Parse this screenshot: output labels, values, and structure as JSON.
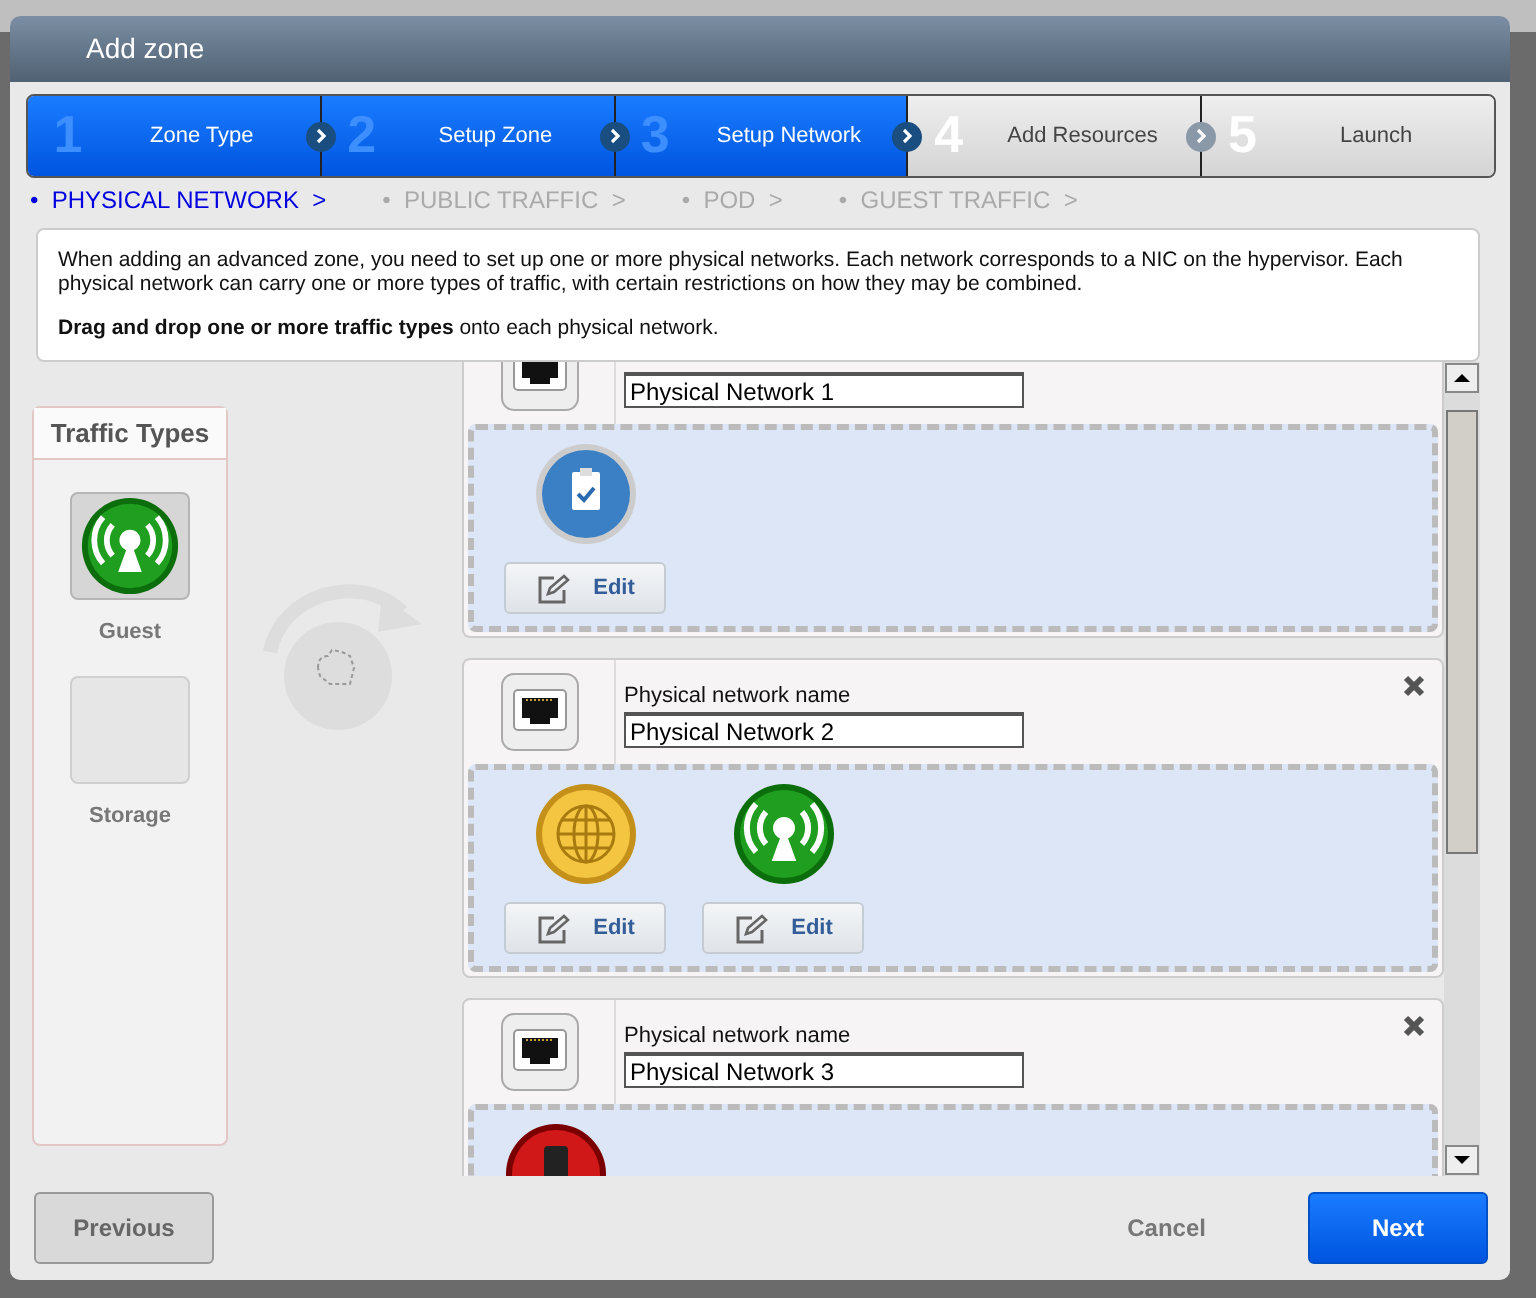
{
  "dialog": {
    "title": "Add zone",
    "steps": [
      {
        "number": "1",
        "label": "Zone Type",
        "completed": true
      },
      {
        "number": "2",
        "label": "Setup Zone",
        "completed": true
      },
      {
        "number": "3",
        "label": "Setup Network",
        "completed": true
      },
      {
        "number": "4",
        "label": "Add Resources",
        "completed": false
      },
      {
        "number": "5",
        "label": "Launch",
        "completed": false
      }
    ],
    "substeps": [
      {
        "bullet": "•",
        "label": "PHYSICAL NETWORK",
        "arrow": ">",
        "selected": true
      },
      {
        "bullet": "•",
        "label": "PUBLIC TRAFFIC",
        "arrow": ">",
        "selected": false
      },
      {
        "bullet": "•",
        "label": "POD",
        "arrow": ">",
        "selected": false
      },
      {
        "bullet": "•",
        "label": "GUEST TRAFFIC",
        "arrow": ">",
        "selected": false
      }
    ],
    "info": {
      "text": "When adding an advanced zone, you need to set up one or more physical networks. Each network corresponds to a NIC on the hypervisor. Each physical network can carry one or more types of traffic, with certain restrictions on how they may be combined.",
      "hint": "**Drag and drop one or more traffic types** onto each physical network."
    },
    "traffic_types": {
      "title": "Traffic Types",
      "items": [
        {
          "label": "Guest",
          "kind": "guest",
          "empty": false
        },
        {
          "label": "Storage",
          "empty": true
        }
      ]
    },
    "networks": [
      {
        "name_value": "Physical Network 1",
        "removable": false,
        "traffic": [
          {
            "kind": "management",
            "edit": "Edit"
          }
        ]
      },
      {
        "name_label": "Physical network name",
        "name_value": "Physical Network 2",
        "removable": true,
        "traffic": [
          {
            "kind": "public",
            "edit": "Edit"
          },
          {
            "kind": "guest",
            "edit": "Edit"
          }
        ]
      },
      {
        "name_label": "Physical network name",
        "name_value": "Physical Network 3",
        "removable": true,
        "traffic": [
          {
            "kind": "storage"
          }
        ]
      }
    ],
    "buttons": {
      "previous": "Previous",
      "cancel": "Cancel",
      "next": "Next"
    }
  }
}
